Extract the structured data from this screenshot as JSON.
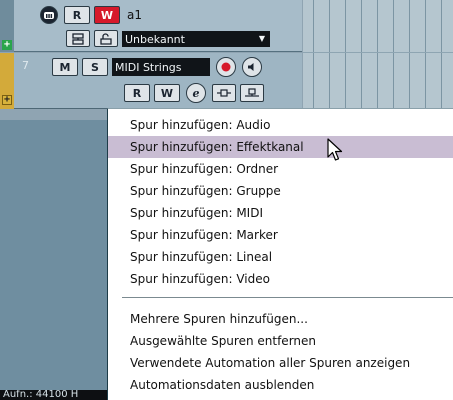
{
  "track1": {
    "name": "a1",
    "monitor_label": "◍",
    "read_label": "R",
    "write_label": "W",
    "output_select": "Unbekannt"
  },
  "track2": {
    "number": "7",
    "mute_label": "M",
    "solo_label": "S",
    "name": "MIDI Strings",
    "read_label": "R",
    "write_label": "W",
    "edit_label": "e"
  },
  "status": {
    "text": "Aufn.: 44100 H"
  },
  "context_menu": {
    "items": [
      {
        "label": "Spur hinzufügen: Audio",
        "highlighted": false
      },
      {
        "label": "Spur hinzufügen: Effektkanal",
        "highlighted": true
      },
      {
        "label": "Spur hinzufügen: Ordner",
        "highlighted": false
      },
      {
        "label": "Spur hinzufügen: Gruppe",
        "highlighted": false
      },
      {
        "label": "Spur hinzufügen: MIDI",
        "highlighted": false
      },
      {
        "label": "Spur hinzufügen: Marker",
        "highlighted": false
      },
      {
        "label": "Spur hinzufügen: Lineal",
        "highlighted": false
      },
      {
        "label": "Spur hinzufügen: Video",
        "highlighted": false
      },
      {
        "label": "Mehrere Spuren hinzufügen...",
        "highlighted": false
      },
      {
        "label": "Ausgewählte Spuren entfernen",
        "highlighted": false
      },
      {
        "label": "Verwendete Automation aller Spuren anzeigen",
        "highlighted": false
      },
      {
        "label": "Automationsdaten ausblenden",
        "highlighted": false
      }
    ]
  },
  "colors": {
    "track_midi_stripe": "#d3aa3a",
    "write_red": "#d6192a",
    "menu_highlight": "#c9bdd3"
  }
}
